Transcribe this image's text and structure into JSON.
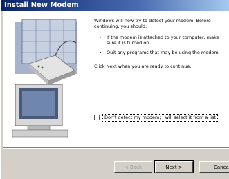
{
  "window": {
    "title": "Install New Modem"
  },
  "content": {
    "intro": "Windows will now try to detect your modem. Before continuing, you should:",
    "bullets": [
      "If the modem is attached to your computer, make sure it is turned on.",
      "Quit any programs that may be using the modem."
    ],
    "instruction": "Click Next when you are ready to continue."
  },
  "checkbox": {
    "label": "Don't detect my modem; I will select it from a list",
    "checked": false
  },
  "buttons": {
    "back": "< Back",
    "next": "Next >",
    "cancel": "Cancel"
  },
  "colors": {
    "titlebar": "#0a246a",
    "face": "#d4d0c8"
  }
}
